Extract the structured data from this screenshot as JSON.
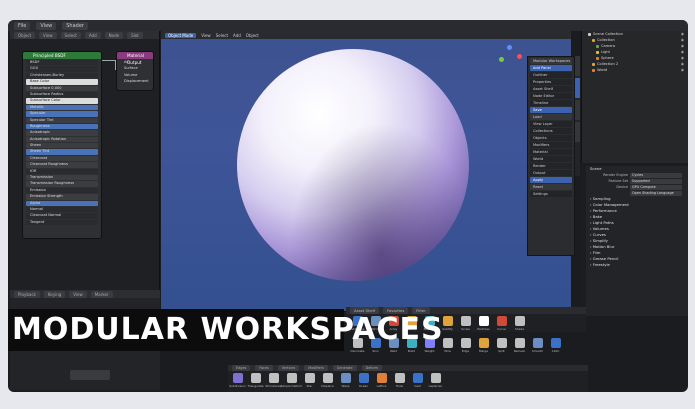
{
  "banner": {
    "title": "MODULAR WORKSPACES"
  },
  "topbar": {
    "items": [
      "File",
      "View",
      "Shader"
    ]
  },
  "node_editor": {
    "header": [
      "Object",
      "View",
      "Select",
      "Add",
      "Node",
      "Slot"
    ],
    "bsdf": {
      "title": "Principled BSDF",
      "rows": [
        {
          "label": "BSDF",
          "style": "dark"
        },
        {
          "label": "GGX",
          "style": "dark"
        },
        {
          "label": "Christensen-Burley",
          "style": "dark"
        },
        {
          "label": "Base Color",
          "style": "white"
        },
        {
          "label": "Subsurface 0.000",
          "style": "normal"
        },
        {
          "label": "Subsurface Radius",
          "style": "dark"
        },
        {
          "label": "Subsurface Color",
          "style": "white"
        },
        {
          "label": "Metallic",
          "style": "blue"
        },
        {
          "label": "Specular",
          "style": "blue"
        },
        {
          "label": "Specular Tint",
          "style": "normal"
        },
        {
          "label": "Roughness",
          "style": "blue"
        },
        {
          "label": "Anisotropic",
          "style": "normal"
        },
        {
          "label": "Anisotropic Rotation",
          "style": "normal"
        },
        {
          "label": "Sheen",
          "style": "normal"
        },
        {
          "label": "Sheen Tint",
          "style": "blue"
        },
        {
          "label": "Clearcoat",
          "style": "normal"
        },
        {
          "label": "Clearcoat Roughness",
          "style": "normal"
        },
        {
          "label": "IOR",
          "style": "dark"
        },
        {
          "label": "Transmission",
          "style": "normal"
        },
        {
          "label": "Transmission Roughness",
          "style": "normal"
        },
        {
          "label": "Emission",
          "style": "dark"
        },
        {
          "label": "Emission Strength",
          "style": "normal"
        },
        {
          "label": "Alpha",
          "style": "blue"
        },
        {
          "label": "Normal",
          "style": "dark"
        },
        {
          "label": "Clearcoat Normal",
          "style": "dark"
        },
        {
          "label": "Tangent",
          "style": "dark"
        }
      ]
    },
    "output": {
      "title": "Material Output",
      "rows": [
        "All",
        "Surface",
        "Volume",
        "Displacement"
      ]
    }
  },
  "timeline": {
    "header": [
      "Playback",
      "Keying",
      "View",
      "Marker"
    ]
  },
  "viewport": {
    "header": [
      "Object Mode",
      "View",
      "Select",
      "Add",
      "Object"
    ],
    "active": "Object Mode"
  },
  "npanel": {
    "rows": [
      {
        "label": "Modular Workspaces",
        "style": "normal"
      },
      {
        "label": "Add Panel",
        "style": "blue"
      },
      {
        "label": "Outliner",
        "style": "dark"
      },
      {
        "label": "Properties",
        "style": "dark"
      },
      {
        "label": "Asset Shelf",
        "style": "dark"
      },
      {
        "label": "Node Editor",
        "style": "dark"
      },
      {
        "label": "Timeline",
        "style": "dark"
      },
      {
        "label": "Save",
        "style": "blue"
      },
      {
        "label": "Load",
        "style": "normal"
      },
      {
        "label": "View Layer",
        "style": "dark"
      },
      {
        "label": "Collections",
        "style": "dark"
      },
      {
        "label": "Objects",
        "style": "dark"
      },
      {
        "label": "Modifiers",
        "style": "dark"
      },
      {
        "label": "Material",
        "style": "dark"
      },
      {
        "label": "World",
        "style": "dark"
      },
      {
        "label": "Render",
        "style": "dark"
      },
      {
        "label": "Output",
        "style": "dark"
      },
      {
        "label": "Apply",
        "style": "blue"
      },
      {
        "label": "Reset",
        "style": "normal"
      },
      {
        "label": "Settings",
        "style": "dark"
      }
    ]
  },
  "outliner": {
    "rows": [
      {
        "label": "Scene Collection",
        "color": "#cfcfcf"
      },
      {
        "label": "Collection",
        "color": "#e0a23a"
      },
      {
        "label": "Camera",
        "color": "#6aa84f"
      },
      {
        "label": "Light",
        "color": "#e0c23a"
      },
      {
        "label": "Sphere",
        "color": "#e07f3a"
      },
      {
        "label": "Collection 2",
        "color": "#e0a23a"
      },
      {
        "label": "World",
        "color": "#e07f3a"
      }
    ]
  },
  "properties": {
    "title": "Scene",
    "fields": [
      {
        "label": "Render Engine",
        "value": "Cycles"
      },
      {
        "label": "Feature Set",
        "value": "Supported"
      },
      {
        "label": "Device",
        "value": "GPU Compute"
      },
      {
        "label": "",
        "value": "Open Shading Language"
      }
    ],
    "sections": [
      "Sampling",
      "Color Management",
      "Performance",
      "Bake",
      "Light Paths",
      "Volumes",
      "Curves",
      "Simplify",
      "Motion Blur",
      "Film",
      "Grease Pencil",
      "Freestyle"
    ]
  },
  "shelf": {
    "header": [
      "Asset Shelf",
      "Favorites",
      "Filter"
    ],
    "row1": [
      {
        "name": "Add Cube",
        "color": "#3a72c8"
      },
      {
        "name": "Mirror",
        "color": "#6a8fc0"
      },
      {
        "name": "Array",
        "color": "#d04a3a"
      },
      {
        "name": "Bevel",
        "color": "#e0a23a"
      },
      {
        "name": "Boolean",
        "color": "#3ab0c0"
      },
      {
        "name": "Solidify",
        "color": "#e0a23a"
      },
      {
        "name": "Screw",
        "color": "#c0c0c0"
      },
      {
        "name": "Particles",
        "color": "#ffffff"
      },
      {
        "name": "Curve",
        "color": "#d04a3a"
      },
      {
        "name": "Shade",
        "color": "#c0c0c0"
      }
    ],
    "row2": [
      {
        "name": "Decimate",
        "color": "#c0c0c0"
      },
      {
        "name": "Skin",
        "color": "#3a72c8"
      },
      {
        "name": "Weld",
        "color": "#6a8fc0"
      },
      {
        "name": "Build",
        "color": "#3ab0c0"
      },
      {
        "name": "Weight",
        "color": "#7f7fff"
      },
      {
        "name": "Wire",
        "color": "#c0c0c0"
      },
      {
        "name": "Edge",
        "color": "#c0c0c0"
      },
      {
        "name": "Merge",
        "color": "#e0a23a"
      },
      {
        "name": "Split",
        "color": "#c0c0c0"
      },
      {
        "name": "Remesh",
        "color": "#c0c0c0"
      },
      {
        "name": "Smooth",
        "color": "#6a8fc0"
      },
      {
        "name": "Cloth",
        "color": "#3a72c8"
      }
    ]
  },
  "shelf2": {
    "header": [
      "Edges",
      "Faces",
      "Vertices",
      "Modifiers",
      "Generate",
      "Deform"
    ],
    "items": [
      {
        "name": "Subdivision",
        "color": "#7f6fd0"
      },
      {
        "name": "Triangulate",
        "color": "#c0c0c0"
      },
      {
        "name": "Shrinkwrap",
        "color": "#c0c0c0"
      },
      {
        "name": "Simple Deform",
        "color": "#c0c0c0"
      },
      {
        "name": "Star",
        "color": "#c0c0c0"
      },
      {
        "name": "Displace",
        "color": "#c0c0c0"
      },
      {
        "name": "Wave",
        "color": "#6a8fc0"
      },
      {
        "name": "Ocean",
        "color": "#3a72c8"
      },
      {
        "name": "Lattice",
        "color": "#e07f3a"
      },
      {
        "name": "Hook",
        "color": "#c0c0c0"
      },
      {
        "name": "Cast",
        "color": "#3a72c8"
      },
      {
        "name": "Laplacian",
        "color": "#c0c0c0"
      }
    ]
  }
}
